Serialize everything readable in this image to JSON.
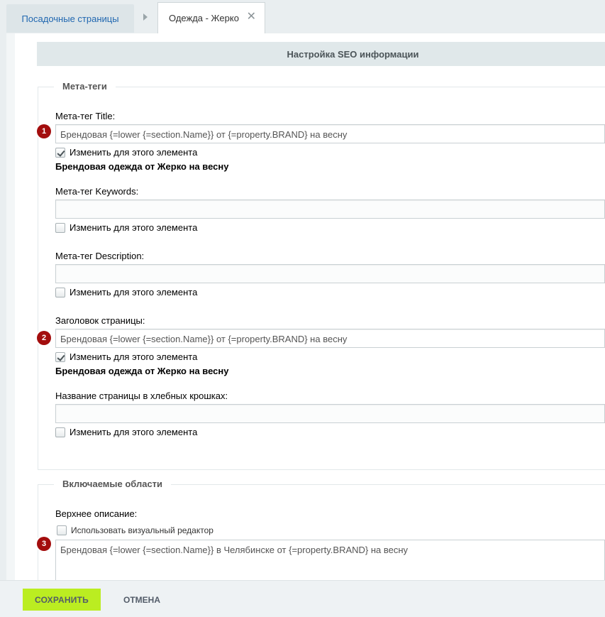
{
  "tabs": {
    "tab1": "Посадочные страницы",
    "tab2": "Одежда - Жерко",
    "tab2_close": "✕"
  },
  "section_title": "Настройка SEO информации",
  "meta": {
    "legend": "Мета-теги",
    "title": {
      "label": "Мета-тег Title:",
      "value": "Брендовая {=lower {=section.Name}} от {=property.BRAND} на весну",
      "checkbox": "Изменить для этого элемента",
      "checked": true,
      "result": "Брендовая одежда от Жерко на весну",
      "badge": "1"
    },
    "keywords": {
      "label": "Мета-тег Keywords:",
      "value": "",
      "checkbox": "Изменить для этого элемента",
      "checked": false
    },
    "description": {
      "label": "Мета-тег Description:",
      "value": "",
      "checkbox": "Изменить для этого элемента",
      "checked": false
    },
    "page_heading": {
      "label": "Заголовок страницы:",
      "value": "Брендовая {=lower {=section.Name}} от {=property.BRAND} на весну",
      "checkbox": "Изменить для этого элемента",
      "checked": true,
      "result": "Брендовая одежда от Жерко на весну",
      "badge": "2"
    },
    "breadcrumb_name": {
      "label": "Название страницы в хлебных крошках:",
      "value": "",
      "checkbox": "Изменить для этого элемента",
      "checked": false
    }
  },
  "includes": {
    "legend": "Включаемые области",
    "top_desc": {
      "label": "Верхнее описание:",
      "checkbox": "Использовать визуальный редактор",
      "checked": false,
      "value": "Брендовая {=lower {=section.Name}} в Челябинске от {=property.BRAND} на весну",
      "badge": "3"
    }
  },
  "footer": {
    "save": "СОХРАНИТЬ",
    "cancel": "ОТМЕНА"
  }
}
